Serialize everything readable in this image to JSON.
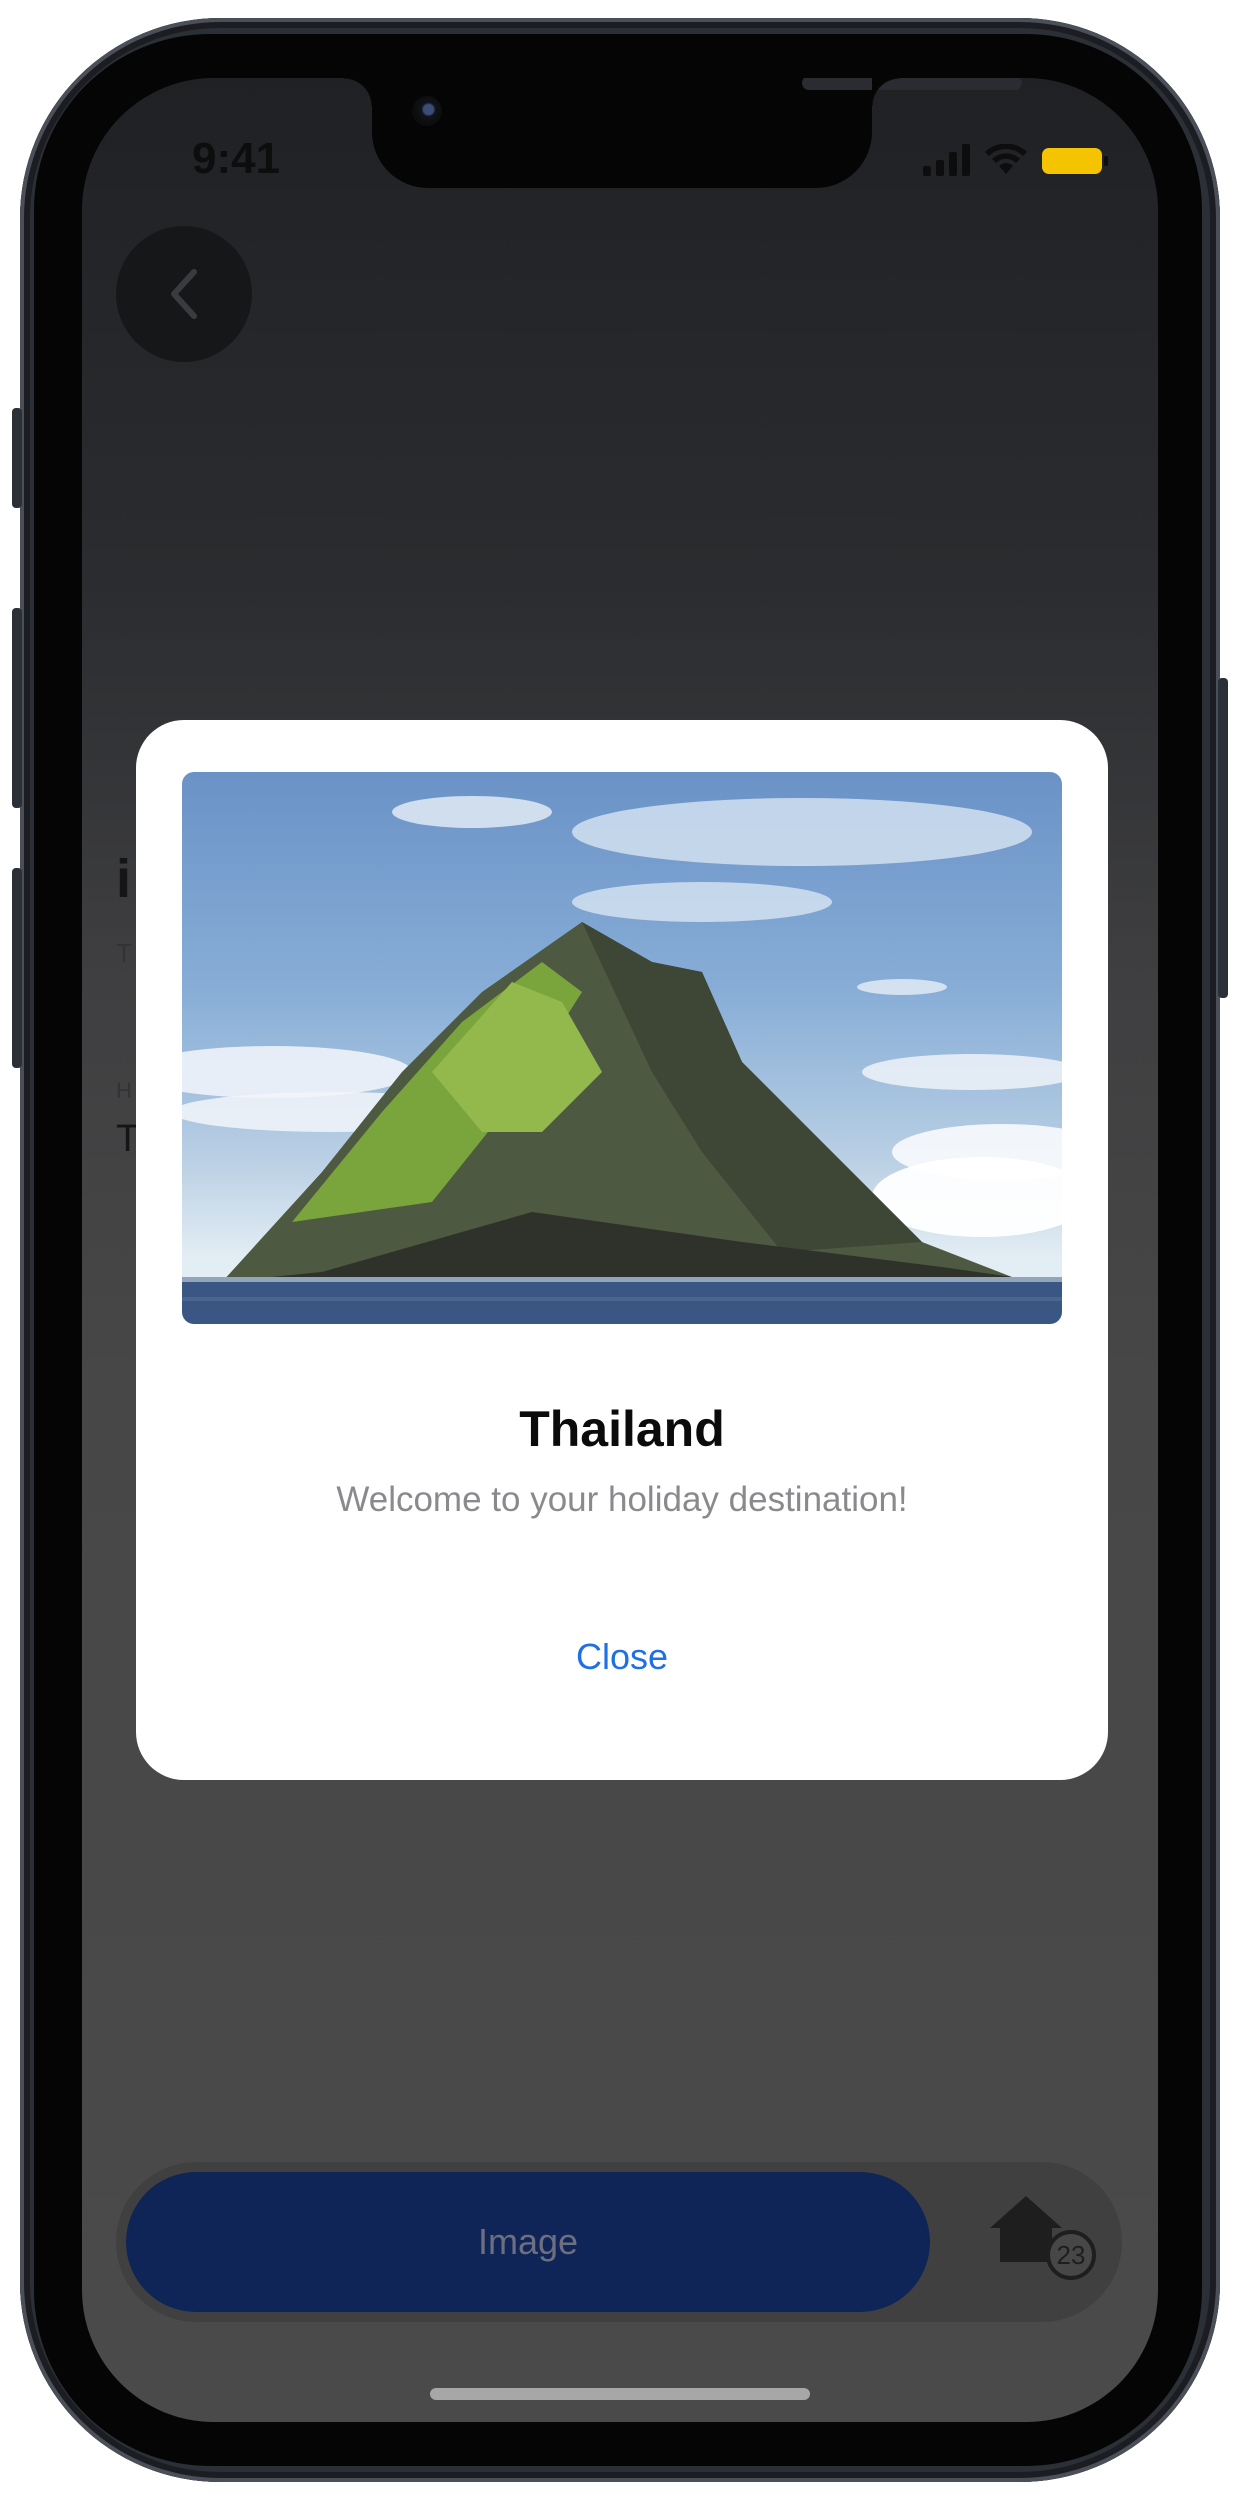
{
  "status_bar": {
    "time": "9:41",
    "signal_icon": "cellular-signal-icon",
    "wifi_icon": "wifi-icon",
    "battery_icon": "battery-icon",
    "battery_color": "#f5c400"
  },
  "header": {
    "back_icon": "chevron-left-icon"
  },
  "background_content": {
    "title": "i",
    "subtitle": "T",
    "label": "H",
    "value": "T"
  },
  "modal": {
    "image": "rocky island mountain in the sea under cloudy blue sky",
    "title": "Thailand",
    "subtitle": "Welcome to your holiday destination!",
    "close_label": "Close",
    "accent_color": "#1f6fe5"
  },
  "bottom_bar": {
    "image_button_label": "Image",
    "home_icon": "home-icon",
    "badge_count": "23",
    "button_color": "#0f2557"
  }
}
